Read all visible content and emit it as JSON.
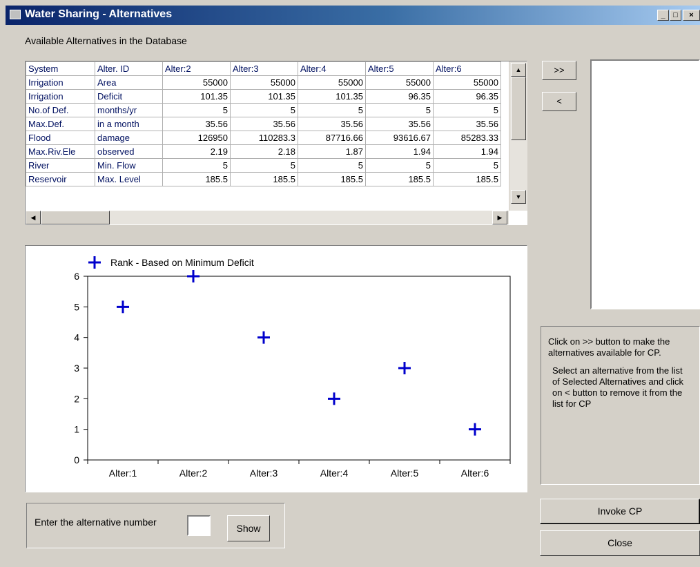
{
  "window": {
    "title": "Water Sharing - Alternatives",
    "buttons": {
      "minimize": "_",
      "maximize": "□",
      "close": "×"
    }
  },
  "grid": {
    "label": "Available Alternatives in the Database",
    "headers": [
      "System",
      "Alter. ID",
      "Alter:2",
      "Alter:3",
      "Alter:4",
      "Alter:5",
      "Alter:6"
    ],
    "rows": [
      [
        "Irrigation",
        "Area",
        "55000",
        "55000",
        "55000",
        "55000",
        "55000"
      ],
      [
        "Irrigation",
        "Deficit",
        "101.35",
        "101.35",
        "101.35",
        "96.35",
        "96.35"
      ],
      [
        "No.of Def.",
        "months/yr",
        "5",
        "5",
        "5",
        "5",
        "5"
      ],
      [
        "Max.Def.",
        "in a month",
        "35.56",
        "35.56",
        "35.56",
        "35.56",
        "35.56"
      ],
      [
        "Flood",
        "damage",
        "126950",
        "110283.3",
        "87716.66",
        "93616.67",
        "85283.33"
      ],
      [
        "Max.Riv.Ele",
        "observed",
        "2.19",
        "2.18",
        "1.87",
        "1.94",
        "1.94"
      ],
      [
        "River",
        "Min. Flow",
        "5",
        "5",
        "5",
        "5",
        "5"
      ],
      [
        "Reservoir",
        "Max. Level",
        "185.5",
        "185.5",
        "185.5",
        "185.5",
        "185.5"
      ]
    ]
  },
  "buttons": {
    "add": ">>",
    "remove": "<",
    "invoke": "Invoke CP",
    "close": "Close",
    "show": "Show"
  },
  "info": {
    "line1": "Click on >>  button to make the alternatives available for CP.",
    "line2": "Select an alternative from the list of Selected Alternatives and click on < button to remove it from the list for CP"
  },
  "enter": {
    "label": "Enter the alternative number",
    "value": ""
  },
  "chart_data": {
    "type": "scatter",
    "categories": [
      "Alter:1",
      "Alter:2",
      "Alter:3",
      "Alter:4",
      "Alter:5",
      "Alter:6"
    ],
    "series": [
      {
        "name": "Rank - Based on Minimum Deficit",
        "values": [
          5,
          6,
          4,
          2,
          3,
          1
        ],
        "color": "#0000cc",
        "marker": "plus"
      }
    ],
    "ylim": [
      0,
      6
    ],
    "yticks": [
      "0",
      "1",
      "2",
      "3",
      "4",
      "5",
      "6"
    ],
    "legend": "top-left",
    "grid": false
  }
}
